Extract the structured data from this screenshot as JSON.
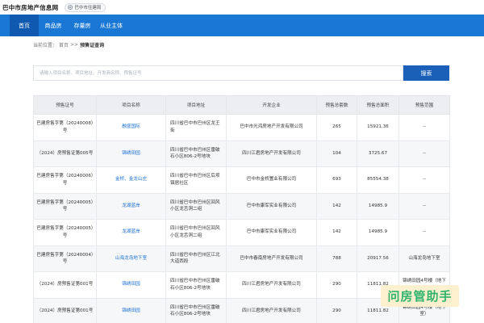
{
  "header": {
    "site_title": "巴中市房地产信息网",
    "org_chip": "巴中市住建局"
  },
  "nav": [
    "首页",
    "商品房",
    "存量房",
    "从业主体"
  ],
  "breadcrumb": {
    "prefix": "当前位置：",
    "home": "首页",
    "sep": ">>",
    "current": "预售证查询"
  },
  "search": {
    "placeholder": "请输入项目名称、项目地址、开发商名称、预售证号",
    "button": "搜索"
  },
  "table": {
    "headers": [
      "预售证号",
      "项目名称",
      "项目地址",
      "开发企业",
      "预售总套数",
      "预售总面积",
      "预售范围"
    ],
    "rows": [
      [
        "巴建房售字第（20240008）号",
        "融盛国际",
        "四川省巴中市巴州区龙王街",
        "巴中市光鸿房地产开发有限公司",
        "265",
        "15921.36",
        "--"
      ],
      [
        "（2024）房预售证第005号",
        "锦绣田园",
        "四川省巴中市巴州区雷破石小区806-2号地块",
        "四川江君房地产开发有限公司",
        "104",
        "3725.67",
        "--"
      ],
      [
        "巴建房售字第（20240006）号",
        "金桥、金龙山庄",
        "四川省巴中市巴州区后坝镇居社区",
        "巴中市金桥置业有限公司",
        "693",
        "85554.38",
        "--"
      ],
      [
        "巴建房售字第（20240005）号",
        "龙湖蓝岸",
        "四川省巴中市巴州区回风小区龙舌洞二组",
        "巴中市康军实业有限公司",
        "142",
        "14985.9",
        "--"
      ],
      [
        "巴建房售字第（20240005）号",
        "龙湖蓝岸",
        "四川省巴中市巴州区回风小区龙舌洞二组",
        "巴中市康军实业有限公司",
        "142",
        "14985.9",
        "--"
      ],
      [
        "巴建房售字第（20240004）号",
        "山海龙岛地下室",
        "四川省巴中市巴州区江北大道西段",
        "巴中市春南房地产开发有限公司",
        "788",
        "20917.56",
        "山海龙岛地下室"
      ],
      [
        "（2024）房预售证第001号",
        "锦绣田园",
        "四川省巴中市巴州区雷破石小区806-2号地块",
        "四川江君房地产开发有限公司",
        "290",
        "11811.82",
        "锦绣田园4号楼（地下室）"
      ],
      [
        "（2024）房预售证第001号",
        "锦绣田园",
        "四川省巴中市巴州区雷破石小区806-2号地块",
        "四川江君房地产开发有限公司",
        "290",
        "11811.82",
        "锦绣田园4号楼（地下室）"
      ]
    ]
  },
  "watermark": "问房管助手",
  "colors": {
    "nav_bg": "#1a78d4",
    "nav_active": "#0f5ab0",
    "search_button": "#1a5fb8",
    "link": "#1a6fd0",
    "watermark_text": "#2fb36d",
    "watermark_bg": "#fdf0ce"
  }
}
